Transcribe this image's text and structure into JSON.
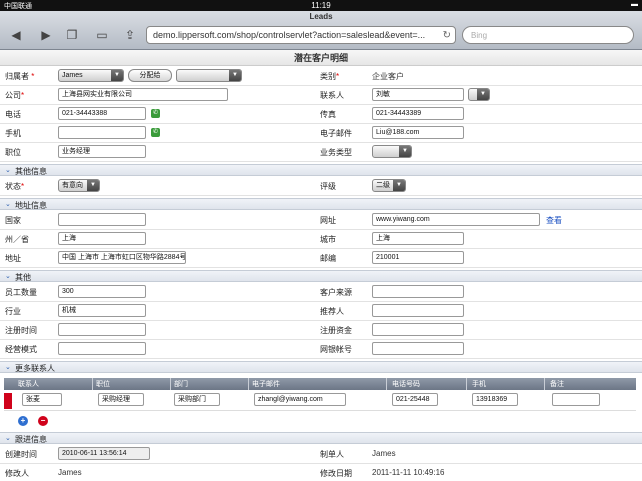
{
  "status": {
    "carrier": "中国联通",
    "time": "11:19",
    "battery": "▬"
  },
  "browser": {
    "title": "Leads",
    "url": "demo.lippersoft.com/shop/controlservlet?action=saleslead&event=...",
    "search_placeholder": "Bing"
  },
  "page": {
    "title": "潜在客户明细"
  },
  "fields": {
    "owner_label": "归属者",
    "owner_value": "James",
    "assign_button": "分配给",
    "assign_target": "",
    "category_label": "类别",
    "category_value": "企业客户",
    "company_label": "公司",
    "company_value": "上海县网实业有限公司",
    "contact_label": "联系人",
    "contact_value": "刘敏",
    "contact_select": "",
    "phone_label": "电话",
    "phone_value": "021-34443388",
    "fax_label": "传真",
    "fax_value": "021-34443389",
    "mobile_label": "手机",
    "mobile_value": "",
    "email_label": "电子邮件",
    "email_value": "Liu@188.com",
    "title_label": "职位",
    "title_value": "业务经理",
    "bizType_label": "业务类型",
    "bizType_value": ""
  },
  "sections": {
    "other_info": "其他信息",
    "address_info": "地址信息",
    "other": "其他",
    "more_contacts": "更多联系人",
    "trace": "跟进信息"
  },
  "other_info": {
    "state_label": "状态",
    "state_value": "有意向",
    "rating_label": "评级",
    "rating_value": "二级"
  },
  "address": {
    "country_label": "国家",
    "country_value": "",
    "website_label": "网址",
    "website_value": "www.yiwang.com",
    "view_link": "查看",
    "province_label": "州／省",
    "province_value": "上海",
    "city_label": "城市",
    "city_value": "上海",
    "address_label": "地址",
    "address_value": "中国 上海市 上海市虹口区物华路2884号",
    "zip_label": "邮编",
    "zip_value": "210001"
  },
  "other": {
    "staff_label": "员工数量",
    "staff_value": "300",
    "source_label": "客户来源",
    "source_value": "",
    "industry_label": "行业",
    "industry_value": "机械",
    "referrer_label": "推荐人",
    "referrer_value": "",
    "regdate_label": "注册时间",
    "regdate_value": "",
    "capital_label": "注册资金",
    "capital_value": "",
    "mode_label": "经营模式",
    "mode_value": "",
    "account_label": "网银帐号",
    "account_value": ""
  },
  "contacts_table": {
    "headers": [
      "联系人",
      "职位",
      "部门",
      "电子邮件",
      "电话号码",
      "手机",
      "备注"
    ],
    "rows": [
      [
        "张麦",
        "采购经理",
        "采购部门",
        "zhangl@yiwang.com",
        "021-25448",
        "13918369",
        ""
      ]
    ]
  },
  "trace": {
    "created_label": "创建时间",
    "created_value": "2010-06-11 13:56:14",
    "creator_label": "制单人",
    "creator_value": "James",
    "modifier_label": "修改人",
    "modifier_value": "James",
    "modified_label": "修改日期",
    "modified_value": "2011-11-11 10:49:16"
  },
  "colors": {
    "required": "#dd0000",
    "link": "#1a4fc1",
    "section": "#dfe4ec"
  }
}
